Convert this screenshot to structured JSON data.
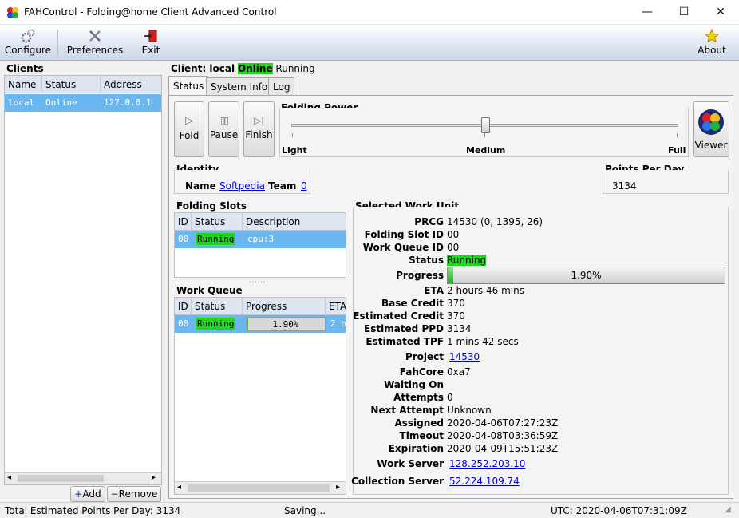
{
  "window": {
    "title": "FAHControl - Folding@home Client Advanced Control",
    "minimize": "—",
    "maximize": "☐",
    "close": "✕"
  },
  "toolbar": {
    "configure": "Configure",
    "preferences": "Preferences",
    "exit": "Exit",
    "about": "About"
  },
  "clients": {
    "title": "Clients",
    "columns": [
      "Name",
      "Status",
      "Address"
    ],
    "rows": [
      {
        "name": "local",
        "status": "Online",
        "address": "127.0.0.1"
      }
    ],
    "add_label": "Add",
    "remove_label": "Remove"
  },
  "client_header": {
    "prefix": "Client: local",
    "online": "Online",
    "state": "Running"
  },
  "tabs": [
    "Status",
    "System Info",
    "Log"
  ],
  "controls": {
    "fold": "Fold",
    "pause": "Pause",
    "finish": "Finish",
    "viewer": "Viewer"
  },
  "folding_power": {
    "title": "Folding Power",
    "light": "Light",
    "medium": "Medium",
    "full": "Full",
    "level": 0.5
  },
  "identity": {
    "title": "Identity",
    "name_label": "Name",
    "name_value": "Softpedia",
    "team_label": "Team",
    "team_value": "0"
  },
  "ppd": {
    "title": "Points Per Day",
    "value": "3134"
  },
  "folding_slots": {
    "title": "Folding Slots",
    "columns": [
      "ID",
      "Status",
      "Description"
    ],
    "rows": [
      {
        "id": "00",
        "status": "Running",
        "description": "cpu:3"
      }
    ]
  },
  "work_queue": {
    "title": "Work Queue",
    "columns": [
      "ID",
      "Status",
      "Progress",
      "ETA"
    ],
    "rows": [
      {
        "id": "00",
        "status": "Running",
        "progress": "1.90%",
        "eta": "2 h"
      }
    ],
    "progress_value": 0.019
  },
  "work_unit": {
    "title": "Selected Work Unit",
    "prcg_label": "PRCG",
    "prcg": "14530 (0, 1395, 26)",
    "slot_label": "Folding Slot ID",
    "slot": "00",
    "queue_label": "Work Queue ID",
    "queue": "00",
    "status_label": "Status",
    "status": "Running",
    "progress_label": "Progress",
    "progress": "1.90%",
    "progress_value": 0.019,
    "eta_label": "ETA",
    "eta": "2 hours 46 mins",
    "base_credit_label": "Base Credit",
    "base_credit": "370",
    "est_credit_label": "Estimated Credit",
    "est_credit": "370",
    "est_ppd_label": "Estimated PPD",
    "est_ppd": "3134",
    "est_tpf_label": "Estimated TPF",
    "est_tpf": "1 mins 42 secs",
    "project_label": "Project",
    "project": "14530",
    "fahcore_label": "FahCore",
    "fahcore": "0xa7",
    "waiting_label": "Waiting On",
    "waiting": "",
    "attempts_label": "Attempts",
    "attempts": "0",
    "next_attempt_label": "Next Attempt",
    "next_attempt": "Unknown",
    "assigned_label": "Assigned",
    "assigned": "2020-04-06T07:27:23Z",
    "timeout_label": "Timeout",
    "timeout": "2020-04-08T03:36:59Z",
    "expiration_label": "Expiration",
    "expiration": "2020-04-09T15:51:23Z",
    "work_server_label": "Work Server",
    "work_server": "128.252.203.10",
    "collection_server_label": "Collection Server",
    "collection_server": "52.224.109.74"
  },
  "statusbar": {
    "total": "Total Estimated Points Per Day: 3134",
    "saving": "Saving...",
    "utc": "UTC: 2020-04-06T07:31:09Z"
  },
  "colors": {
    "running": "#22d322",
    "selection": "#6ab8ef",
    "link": "#0000cc"
  }
}
